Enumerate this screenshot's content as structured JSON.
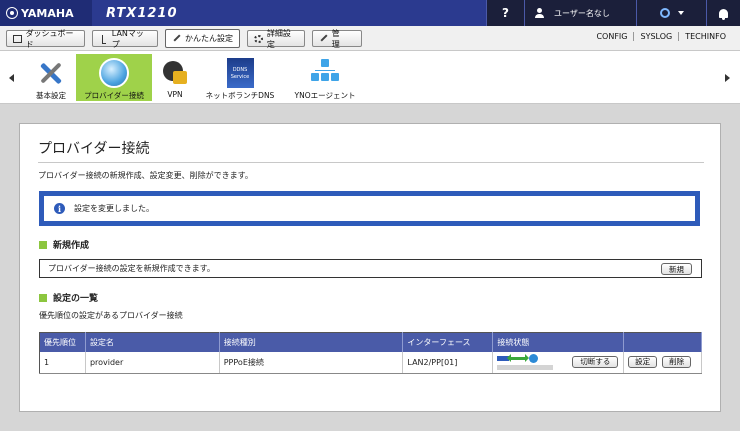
{
  "brand": {
    "name": "YAMAHA",
    "model": "RTX1210"
  },
  "topbar": {
    "help": "?",
    "user_label": "ユーザー名なし"
  },
  "tabs": [
    {
      "label": "ダッシュボード"
    },
    {
      "label": "LANマップ"
    },
    {
      "label": "かんたん設定"
    },
    {
      "label": "詳細設定"
    },
    {
      "label": "管　理"
    }
  ],
  "top_links": [
    "CONFIG",
    "SYSLOG",
    "TECHINFO"
  ],
  "icon_strip": {
    "items": [
      {
        "label": "基本設定"
      },
      {
        "label": "プロバイダー接続"
      },
      {
        "label": "VPN"
      },
      {
        "label": "ネットボランチDNS"
      },
      {
        "label": "YNOエージェント"
      }
    ],
    "ddns_text": [
      "DDNS",
      "Service"
    ]
  },
  "page": {
    "title": "プロバイダー接続",
    "description": "プロバイダー接続の新規作成、設定変更、削除ができます。",
    "notice": "設定を変更しました。",
    "new_section": {
      "heading": "新規作成",
      "text": "プロバイダー接続の設定を新規作成できます。",
      "button": "新規"
    },
    "list_section": {
      "heading": "設定の一覧",
      "text": "優先順位の設定があるプロバイダー接続"
    },
    "table": {
      "headers": [
        "優先順位",
        "設定名",
        "接続種別",
        "インターフェース",
        "接続状態",
        ""
      ],
      "rows": [
        {
          "priority": "1",
          "name": "provider",
          "type": "PPPoE接続",
          "interface": "LAN2/PP[01]",
          "disconnect_button": "切断する",
          "settings_button": "設定",
          "delete_button": "削除"
        }
      ]
    }
  }
}
